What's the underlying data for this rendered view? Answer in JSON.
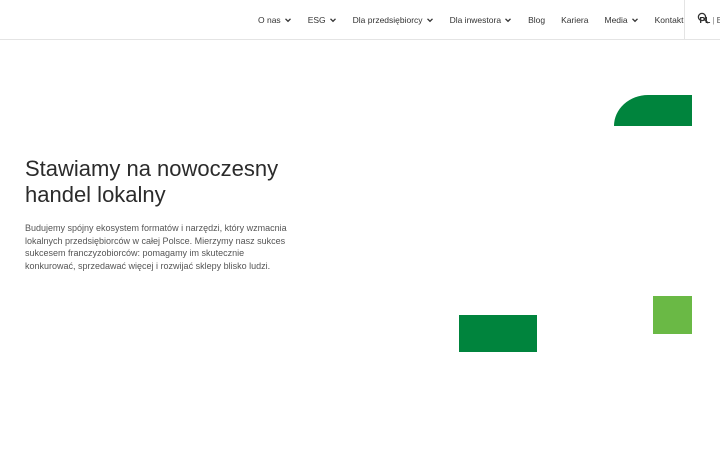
{
  "nav": {
    "items": [
      {
        "label": "O nas",
        "has_dropdown": true
      },
      {
        "label": "ESG",
        "has_dropdown": true
      },
      {
        "label": "Dla przedsiębiorcy",
        "has_dropdown": true
      },
      {
        "label": "Dla inwestora",
        "has_dropdown": true
      },
      {
        "label": "Blog",
        "has_dropdown": false
      },
      {
        "label": "Kariera",
        "has_dropdown": false
      },
      {
        "label": "Media",
        "has_dropdown": true
      },
      {
        "label": "Kontakt",
        "has_dropdown": false
      }
    ],
    "lang": {
      "active": "PL",
      "separator": "|",
      "other": "EN"
    },
    "search_icon": "search-icon",
    "dropdown_icon": "chevron-down-icon"
  },
  "hero": {
    "title_line1": "Stawiamy na nowoczesny",
    "title_line2": "handel lokalny",
    "description": "Budujemy spójny ekosystem formatów i narzędzi, który wzmacnia lokalnych przedsiębiorców w całej Polsce. Mierzymy nasz sukces sukcesem franczyzobiorców: pomagamy im skutecznie konkurować, sprzedawać więcej i rozwijać sklepy blisko ludzi."
  },
  "colors": {
    "brand_dark_green": "#00843d",
    "brand_light_green": "#6ab945",
    "text": "#333333",
    "border": "#e4e4e4"
  }
}
